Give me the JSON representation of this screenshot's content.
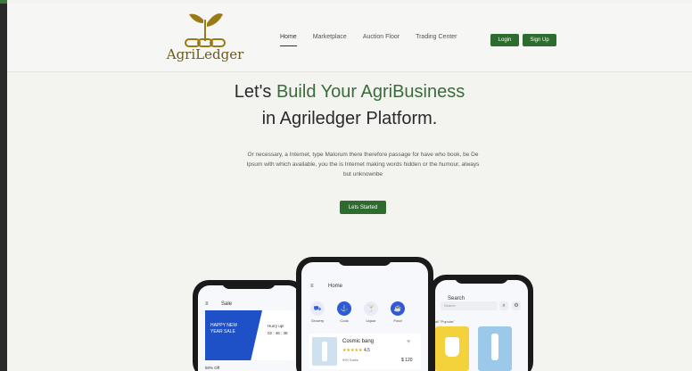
{
  "brand": {
    "name": "AgriLedger"
  },
  "nav": {
    "items": [
      {
        "label": "Home",
        "active": true
      },
      {
        "label": "Marketplace",
        "active": false
      },
      {
        "label": "Auction Floor",
        "active": false
      },
      {
        "label": "Trading Center",
        "active": false
      }
    ],
    "login_label": "Login",
    "signup_label": "Sign Up"
  },
  "hero": {
    "line1_prefix": "Let's ",
    "line1_highlight": "Build Your AgriBusiness",
    "line2": "in Agriledger Platform.",
    "description": "Or necessary, a Internet, type Malorum there therefore passage for have who book, be De Ipsum with which available, you the is Internet making words hidden or the humour, always but unknownbe",
    "cta_label": "Lets Started"
  },
  "phones": {
    "left": {
      "title": "Sale",
      "banner_text": "HAPPY NEW YEAR SALE",
      "hurry": "Hurry up!",
      "timer": "02 : 46 : 38",
      "discount": "50% Off"
    },
    "middle": {
      "title": "Home",
      "categories": [
        {
          "label": "Grocery",
          "icon": "cart-icon"
        },
        {
          "label": "Cook",
          "icon": "cook-icon"
        },
        {
          "label": "Liquor",
          "icon": "liquor-icon"
        },
        {
          "label": "Food",
          "icon": "food-icon"
        }
      ],
      "product": {
        "name": "Cosmic bang",
        "stars": "★★★★★",
        "rating": "4.5",
        "sold": "999 Sales",
        "price": "$ 120"
      }
    },
    "right": {
      "title": "Search",
      "search_placeholder": "Search",
      "popular_label": "all \"Popular\""
    }
  },
  "colors": {
    "accent": "#2e6b2e",
    "hero_green": "#3b6b3b",
    "phone_blue": "#2f59d6",
    "logo_gold": "#6b5a1a"
  }
}
